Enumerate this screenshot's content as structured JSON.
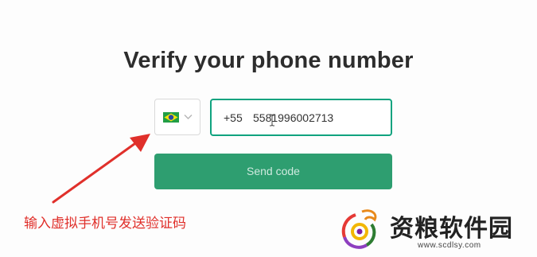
{
  "page": {
    "title": "Verify your phone number"
  },
  "country_select": {
    "selected": "Brazil",
    "flag_icon": "brazil-flag-icon",
    "chevron_icon": "chevron-down-icon"
  },
  "phone_input": {
    "dial_code": "+55",
    "number": "5581996002713",
    "border_color": "#10a37f"
  },
  "send_button": {
    "label": "Send code",
    "color": "#2e9e70"
  },
  "annotation": {
    "text": "输入虚拟手机号发送验证码",
    "color": "#e0302b"
  },
  "watermark": {
    "name": "资粮软件园",
    "url": "www.scdlsy.com"
  }
}
